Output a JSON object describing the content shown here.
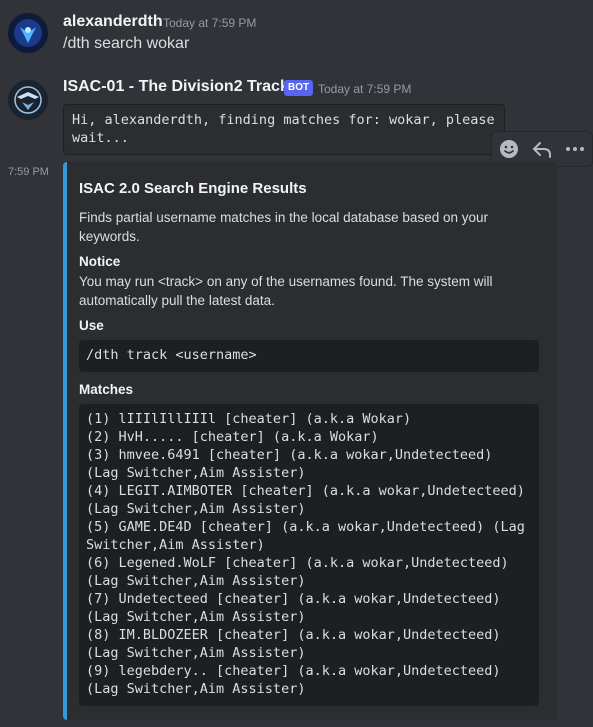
{
  "message1": {
    "username": "alexanderdth",
    "timestamp": "Today at 7:59 PM",
    "text": "/dth search wokar"
  },
  "message2": {
    "username": "ISAC-01 - The Division2 Tracker",
    "badge": "BOT",
    "timestamp": "Today at 7:59 PM",
    "code_text": "Hi, alexanderdth, finding matches for: wokar, please wait..."
  },
  "hover_toolbar": {
    "icons": [
      "add-reaction-icon",
      "reply-icon",
      "more-options-icon"
    ]
  },
  "embed_message": {
    "side_timestamp": "7:59 PM",
    "accent_color": "#3498db",
    "title": "ISAC 2.0 Search Engine Results",
    "description": "Finds partial username matches in the local database based on your keywords.",
    "fields": {
      "notice_name": "Notice",
      "notice_value": "You may run <track> on any of the usernames found. The system will automatically pull the latest data.",
      "use_name": "Use",
      "use_value": "/dth track <username>",
      "matches_name": "Matches",
      "matches": [
        "(1) lIIIlIllIIIl [cheater] (a.k.a Wokar)",
        "(2) HvH..... [cheater] (a.k.a Wokar)",
        "(3) hmvee.6491 [cheater] (a.k.a wokar,Undetecteed) (Lag Switcher,Aim Assister)",
        "(4) LEGIT.AIMBOTER [cheater] (a.k.a wokar,Undetecteed) (Lag Switcher,Aim Assister)",
        "(5) GAME.DE4D [cheater] (a.k.a wokar,Undetecteed) (Lag Switcher,Aim Assister)",
        "(6) Legened.WoLF [cheater] (a.k.a wokar,Undetecteed) (Lag Switcher,Aim Assister)",
        "(7) Undetecteed [cheater] (a.k.a wokar,Undetecteed) (Lag Switcher,Aim Assister)",
        "(8) IM.BLDOZEER [cheater] (a.k.a wokar,Undetecteed) (Lag Switcher,Aim Assister)",
        "(9) legebdery.. [cheater] (a.k.a wokar,Undetecteed) (Lag Switcher,Aim Assister)"
      ]
    }
  }
}
